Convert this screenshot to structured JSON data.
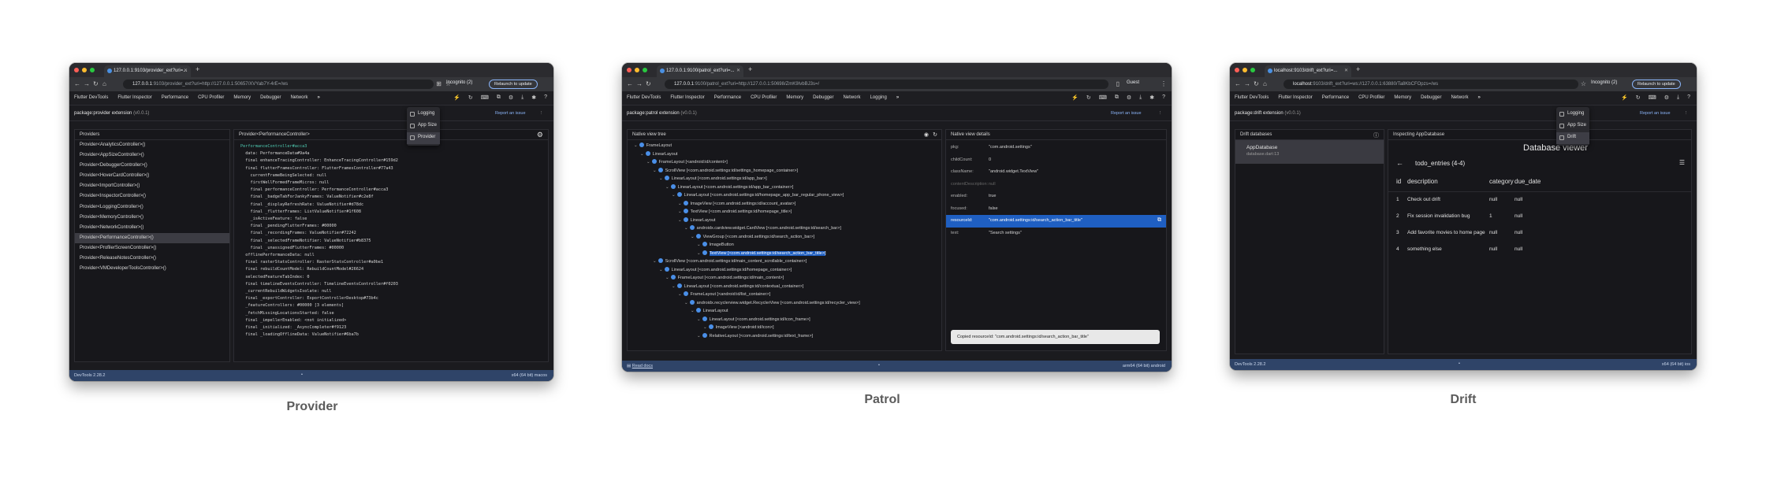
{
  "captions": {
    "provider": "Provider",
    "patrol": "Patrol",
    "drift": "Drift"
  },
  "common": {
    "devtools_tabs": [
      "Flutter DevTools",
      "Flutter Inspector",
      "Performance",
      "CPU Profiler",
      "Memory",
      "Debugger",
      "Network"
    ],
    "overflow": "»",
    "report_issue": "Report an issue"
  },
  "provider": {
    "tab_title": "127.0.0.1:9103/provider_ext?uri=...",
    "url_host": "127.0.0.1",
    "url_rest": ":9103/provider_ext?uri=http://127.0.0.1:50657/XVYab7Y-4rE=/ws",
    "incognito": "Incognito (2)",
    "relaunch": "Relaunch to update",
    "ext_title": "package:provider extension",
    "ext_version": "(v0.0.1)",
    "menu": [
      "Logging",
      "App Size",
      "Provider"
    ],
    "providers_header": "Providers",
    "providers": [
      "Provider<AnalyticsController>()",
      "Provider<AppSizeController>()",
      "Provider<DebuggerController>()",
      "Provider<HoverCardController>()",
      "Provider<ImportController>()",
      "Provider<InspectorController>()",
      "Provider<LoggingController>()",
      "Provider<MemoryController>()",
      "Provider<NetworkController>()",
      "Provider<PerformanceController>()",
      "Provider<ProfilerScreenController>()",
      "Provider<ReleaseNotesController>()",
      "Provider<VMDeveloperToolsController>()"
    ],
    "detail_header": "Provider<PerformanceController>",
    "code_lines": [
      "PerformanceController#acca3",
      "  data: PerformanceData#9a4a",
      "  final enhanceTracingController: EnhanceTracingController#159d2",
      "  final flutterFramesController: FlutterFramesController#77a43",
      "    currentFrameBeingSelected: null",
      "    firstWellFormedFrameMicros: null",
      "    final performanceController: PerformanceController#acca3",
      "    final _badgeTabForJankyFrames: ValueNotifier#c2e8f",
      "    final _displayRefreshRate: ValueNotifier#d78dc",
      "    final _flutterFrames: ListValueNotifier#1f608",
      "    _isActiveFeature: false",
      "    final _pendingFlutterFrames: #00000",
      "    final _recordingFrames: ValueNotifier#72242",
      "    final _selectedFrameNotifier: ValueNotifier#b8375",
      "    final _unassignedFlutterFrames: #00000",
      "  offlinePerformanceData: null",
      "  final rasterStatsController: RasterStatsController#a0be1",
      "  final rebuildCountModel: RebuildCountModel#26624",
      "  selectedFeatureTabIndex: 0",
      "  final timelineEventsController: TimelineEventsController#f0203",
      "  _currentRebuildWidgetsIsolate: null",
      "  final _exportController: ExportControllerDesktop#73b4c",
      "  _featureControllers: #00000 [3 elements]",
      "  _fetchMissingLocationsStarted: false",
      "  final _impellerEnabled: <not initialized>",
      "  final _initialized: _AsyncCompleter#f9123",
      "  final _loadingOfflineData: ValueNotifier#6ba7b"
    ],
    "status_left": "DevTools 2.28.2",
    "status_mid": "•",
    "status_right": "x64 (64 bit) macos"
  },
  "patrol": {
    "tab_title": "127.0.0.1:9100/patrol_ext?uri=...",
    "url_host": "127.0.0.1",
    "url_rest": ":9100/patrol_ext?uri=http://127.0.0.1:50698/ZmK9IvbBJ3s=/",
    "incognito": "Guest",
    "ext_title": "package:patrol extension",
    "ext_version": "(v0.0.1)",
    "extra_tab": "Logging",
    "tree_header": "Native view tree",
    "tree": [
      {
        "d": 0,
        "t": "FrameLayout"
      },
      {
        "d": 1,
        "t": "LinearLayout"
      },
      {
        "d": 2,
        "t": "FrameLayout [<android:id/content>]"
      },
      {
        "d": 3,
        "t": "ScrollView [<com.android.settings:id/settings_homepage_container>]"
      },
      {
        "d": 4,
        "t": "LinearLayout [<com.android.settings:id/app_bar>]"
      },
      {
        "d": 5,
        "t": "LinearLayout [<com.android.settings:id/app_bar_container>]"
      },
      {
        "d": 6,
        "t": "LinearLayout [<com.android.settings:id/homepage_app_bar_regular_phone_view>]"
      },
      {
        "d": 7,
        "t": "ImageView [<com.android.settings:id/account_avatar>]"
      },
      {
        "d": 7,
        "t": "TextView [<com.android.settings:id/homepage_title>]"
      },
      {
        "d": 7,
        "t": "LinearLayout"
      },
      {
        "d": 8,
        "t": "androidx.cardview.widget.CardView [<com.android.settings:id/search_bar>]"
      },
      {
        "d": 9,
        "t": "ViewGroup [<com.android.settings:id/search_action_bar>]"
      },
      {
        "d": 10,
        "t": "ImageButton"
      },
      {
        "d": 10,
        "t": "TextView [<com.android.settings:id/search_action_bar_title>]",
        "hl": true
      },
      {
        "d": 3,
        "t": "ScrollView [<com.android.settings:id/main_content_scrollable_container>]"
      },
      {
        "d": 4,
        "t": "LinearLayout [<com.android.settings:id/homepage_container>]"
      },
      {
        "d": 5,
        "t": "FrameLayout [<com.android.settings:id/main_content>]"
      },
      {
        "d": 6,
        "t": "LinearLayout [<com.android.settings:id/contextual_container>]"
      },
      {
        "d": 7,
        "t": "FrameLayout [<android:id/list_container>]"
      },
      {
        "d": 8,
        "t": "androidx.recyclerview.widget.RecyclerView [<com.android.settings:id/recycler_view>]"
      },
      {
        "d": 9,
        "t": "LinearLayout"
      },
      {
        "d": 10,
        "t": "LinearLayout [<com.android.settings:id/icon_frame>]"
      },
      {
        "d": 11,
        "t": "ImageView [<android:id/icon>]"
      },
      {
        "d": 10,
        "t": "RelativeLayout [<com.android.settings:id/text_frame>]"
      }
    ],
    "details_header": "Native view details",
    "details": [
      {
        "k": "pkg:",
        "v": "\"com.android.settings\""
      },
      {
        "k": "childCount:",
        "v": "0"
      },
      {
        "k": "className:",
        "v": "\"android.widget.TextView\""
      },
      {
        "k": "contentDescription:",
        "v": "null",
        "dim": true
      },
      {
        "k": "enabled:",
        "v": "true"
      },
      {
        "k": "focused:",
        "v": "false"
      },
      {
        "k": "resourceId:",
        "v": "\"com.android.settings:id/search_action_bar_title\"",
        "hl": true
      },
      {
        "k": "text:",
        "v": "\"Search settings\""
      }
    ],
    "toast": "Copied resourceId: \"com.android.settings:id/search_action_bar_title\"",
    "status_left": "Read docs",
    "status_mid": "•",
    "status_right": "arm64 (64 bit) android"
  },
  "drift": {
    "tab_title": "localhost:9103/drift_ext?uri=...",
    "url_host": "localhost",
    "url_rest": ":9103/drift_ext?uri=ws://127.0.0.1:63880/Ta8KbCFOpzs=/ws",
    "incognito": "Incognito (2)",
    "relaunch": "Relaunch to update",
    "ext_title": "package:drift extension",
    "ext_version": "(v0.0.1)",
    "menu": [
      "Logging",
      "App Size",
      "Drift"
    ],
    "db_header": "Drift databases",
    "db_name": "AppDatabase",
    "db_file": "database.dart:13",
    "inspect_header": "Inspecting AppDatabase",
    "viewer_title": "Database viewer",
    "table_name": "todo_entries (4-4)",
    "columns": [
      "id",
      "description",
      "category",
      "due_date"
    ],
    "rows": [
      [
        "1",
        "Check out drift",
        "null",
        "null"
      ],
      [
        "2",
        "Fix session invalidation bug",
        "1",
        "null"
      ],
      [
        "3",
        "Add favorite movies to home page",
        "null",
        "null"
      ],
      [
        "4",
        "something else",
        "null",
        "null"
      ]
    ],
    "status_left": "DevTools 2.28.2",
    "status_mid": "•",
    "status_right": "x64 (64 bit) ios"
  }
}
